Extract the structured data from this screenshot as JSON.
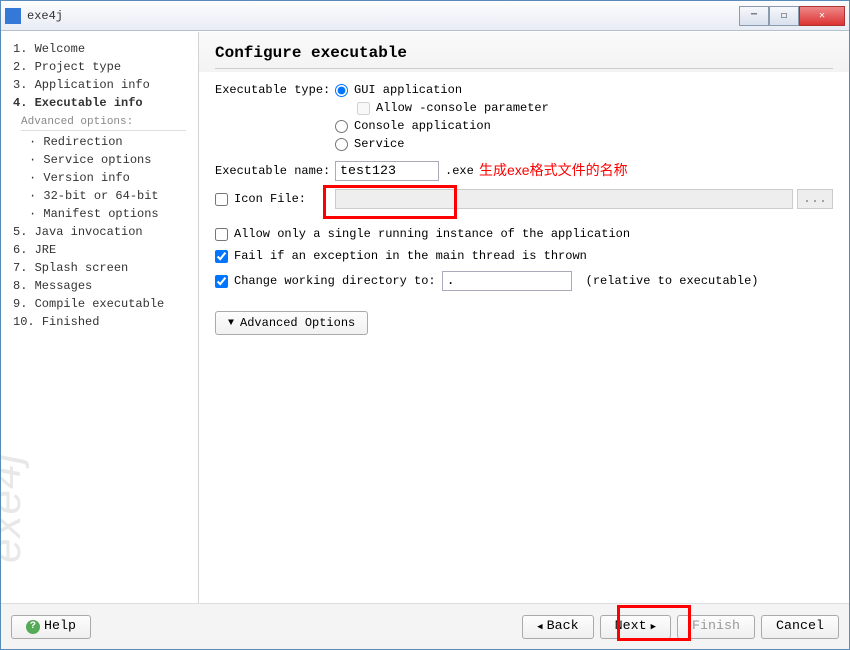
{
  "window": {
    "title": "exe4j"
  },
  "sidebar": {
    "items": [
      {
        "n": "1",
        "label": "Welcome"
      },
      {
        "n": "2",
        "label": "Project type"
      },
      {
        "n": "3",
        "label": "Application info"
      },
      {
        "n": "4",
        "label": "Executable info",
        "active": true
      },
      {
        "n": "5",
        "label": "Java invocation"
      },
      {
        "n": "6",
        "label": "JRE"
      },
      {
        "n": "7",
        "label": "Splash screen"
      },
      {
        "n": "8",
        "label": "Messages"
      },
      {
        "n": "9",
        "label": "Compile executable"
      },
      {
        "n": "10",
        "label": "Finished"
      }
    ],
    "advanced_header": "Advanced options:",
    "advanced": [
      "Redirection",
      "Service options",
      "Version info",
      "32-bit or 64-bit",
      "Manifest options"
    ],
    "watermark": "exe4j"
  },
  "main": {
    "title": "Configure executable",
    "exec_type_label": "Executable type:",
    "type_options": {
      "gui": "GUI application",
      "allow_console": "Allow -console parameter",
      "console": "Console application",
      "service": "Service"
    },
    "exec_name_label": "Executable name:",
    "exec_name_value": "test123",
    "exec_name_suffix": ".exe",
    "icon_file_label": "Icon File:",
    "browse_btn": "...",
    "check_single": "Allow only a single running instance of the application",
    "check_fail": "Fail if an exception in the main thread is thrown",
    "check_cwd": "Change working directory to:",
    "cwd_value": ".",
    "cwd_suffix": "(relative to executable)",
    "advanced_btn": "Advanced Options",
    "annotation_text": "生成exe格式文件的名称"
  },
  "footer": {
    "help": "Help",
    "back": "Back",
    "next": "Next",
    "finish": "Finish",
    "cancel": "Cancel"
  }
}
